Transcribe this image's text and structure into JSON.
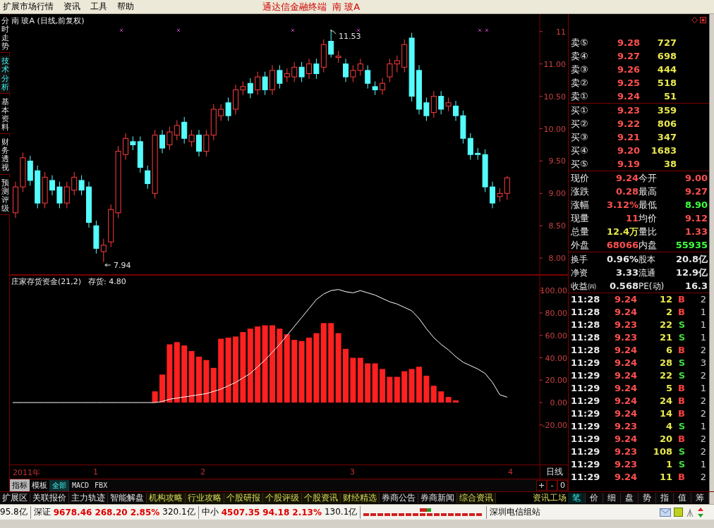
{
  "menu": {
    "items": [
      "扩展市场行情",
      "资讯",
      "工具",
      "帮助"
    ],
    "app_title": "通达信金融终端",
    "stock_title": "南 玻A"
  },
  "side_tabs": [
    {
      "label": "分时走势",
      "selected": false
    },
    {
      "label": "技术分析",
      "selected": true
    },
    {
      "label": "基本资料",
      "selected": false
    },
    {
      "label": "财务透视",
      "selected": false
    },
    {
      "label": "预测评级",
      "selected": false
    }
  ],
  "price_chart": {
    "title": "南 玻A (日线,前复权)",
    "high_label": "11.53",
    "low_label": "7.94",
    "chart_data": {
      "type": "candlestick",
      "ylim": [
        7.74,
        11.77
      ],
      "yticks": [
        {
          "value": 11.5,
          "label": "11"
        },
        {
          "value": 11,
          "label": "11.00"
        },
        {
          "value": 10.5,
          "label": "10.50"
        },
        {
          "value": 10,
          "label": "10.00"
        },
        {
          "value": 9.5,
          "label": "9.50"
        },
        {
          "value": 9,
          "label": "9.00"
        },
        {
          "value": 8.5,
          "label": "8.50"
        },
        {
          "value": 8,
          "label": "8.00"
        }
      ],
      "ohlc": [
        [
          8.7,
          9.18,
          8.62,
          9.1
        ],
        [
          9.1,
          9.63,
          9.02,
          9.55
        ],
        [
          9.5,
          9.58,
          9.12,
          9.2
        ],
        [
          9.35,
          9.43,
          8.77,
          8.85
        ],
        [
          8.85,
          9.33,
          8.77,
          9.25
        ],
        [
          9.2,
          9.28,
          8.97,
          9.05
        ],
        [
          9.1,
          9.18,
          8.77,
          8.85
        ],
        [
          8.85,
          9.18,
          8.77,
          9.1
        ],
        [
          9.05,
          9.33,
          8.97,
          9.25
        ],
        [
          9.2,
          9.28,
          8.97,
          9.05
        ],
        [
          9.1,
          9.18,
          8.47,
          8.55
        ],
        [
          8.5,
          8.58,
          8.07,
          8.15
        ],
        [
          8.1,
          8.3,
          7.94,
          8.2
        ],
        [
          8.25,
          8.83,
          8.17,
          8.75
        ],
        [
          8.7,
          9.73,
          8.62,
          9.65
        ],
        [
          9.6,
          9.93,
          9.52,
          9.85
        ],
        [
          9.8,
          9.88,
          9.67,
          9.75
        ],
        [
          9.8,
          9.88,
          9.32,
          9.4
        ],
        [
          9.35,
          9.43,
          9.07,
          9.15
        ],
        [
          9.0,
          9.98,
          8.92,
          9.9
        ],
        [
          9.9,
          9.98,
          9.62,
          9.7
        ],
        [
          9.75,
          10.03,
          9.67,
          9.95
        ],
        [
          9.9,
          10.13,
          9.82,
          10.05
        ],
        [
          10.1,
          10.18,
          9.77,
          9.85
        ],
        [
          9.8,
          9.98,
          9.72,
          9.9
        ],
        [
          9.9,
          9.98,
          9.57,
          9.65
        ],
        [
          9.65,
          9.98,
          9.57,
          9.9
        ],
        [
          9.9,
          10.38,
          9.82,
          10.3
        ],
        [
          10.2,
          10.38,
          10.12,
          10.3
        ],
        [
          10.4,
          10.48,
          10.12,
          10.2
        ],
        [
          10.3,
          10.68,
          10.22,
          10.6
        ],
        [
          10.6,
          10.73,
          10.52,
          10.65
        ],
        [
          10.7,
          10.78,
          10.47,
          10.55
        ],
        [
          10.6,
          10.88,
          10.52,
          10.8
        ],
        [
          10.8,
          10.88,
          10.52,
          10.6
        ],
        [
          10.6,
          10.98,
          10.52,
          10.9
        ],
        [
          10.9,
          10.98,
          10.62,
          10.7
        ],
        [
          10.8,
          10.93,
          10.72,
          10.85
        ],
        [
          10.8,
          11.03,
          10.72,
          10.95
        ],
        [
          10.95,
          11.03,
          10.72,
          10.8
        ],
        [
          10.85,
          11.08,
          10.77,
          11.0
        ],
        [
          11.0,
          11.08,
          10.77,
          10.85
        ],
        [
          10.95,
          11.38,
          10.87,
          11.3
        ],
        [
          11.35,
          11.53,
          11.1,
          11.15
        ],
        [
          11.1,
          11.2,
          11.02,
          11.12
        ],
        [
          11.0,
          11.08,
          10.72,
          10.8
        ],
        [
          10.8,
          10.98,
          10.72,
          10.9
        ],
        [
          10.9,
          11.08,
          10.82,
          11.0
        ],
        [
          10.9,
          10.98,
          10.62,
          10.7
        ],
        [
          10.65,
          10.73,
          10.52,
          10.6
        ],
        [
          10.6,
          10.78,
          10.52,
          10.7
        ],
        [
          10.8,
          11.08,
          10.72,
          11.0
        ],
        [
          11.0,
          11.13,
          10.87,
          11.05
        ],
        [
          10.95,
          11.38,
          10.87,
          11.3
        ],
        [
          11.4,
          11.48,
          10.42,
          10.5
        ],
        [
          10.9,
          10.98,
          10.22,
          10.3
        ],
        [
          10.4,
          10.48,
          10.12,
          10.2
        ],
        [
          10.25,
          10.58,
          10.17,
          10.5
        ],
        [
          10.5,
          10.58,
          10.22,
          10.3
        ],
        [
          10.35,
          10.48,
          10.27,
          10.4
        ],
        [
          10.35,
          10.43,
          10.12,
          10.2
        ],
        [
          10.2,
          10.28,
          9.77,
          9.85
        ],
        [
          9.85,
          9.93,
          9.52,
          9.6
        ],
        [
          9.62,
          9.7,
          9.52,
          9.6
        ],
        [
          9.6,
          9.68,
          9.02,
          9.1
        ],
        [
          9.1,
          9.18,
          8.77,
          8.85
        ],
        [
          8.95,
          9.08,
          8.87,
          9.0
        ],
        [
          9.0,
          9.27,
          8.9,
          9.24
        ]
      ]
    }
  },
  "indicator_chart": {
    "reading": "存货: 4.80",
    "chart_data": {
      "type": "bar",
      "title": "庄家存货资金(21,2)",
      "ylim": [
        -56,
        114
      ],
      "yticks": [
        {
          "value": 100,
          "label": "100.00"
        },
        {
          "value": 80,
          "label": "80.00"
        },
        {
          "value": 60,
          "label": "60.00"
        },
        {
          "value": 40,
          "label": "40.00"
        },
        {
          "value": 20,
          "label": "20.00"
        },
        {
          "value": 0,
          "label": "0.00"
        },
        {
          "value": -20,
          "label": "-20.00"
        }
      ],
      "series": [
        {
          "type": "bar",
          "color": "#ff2020",
          "values": [
            null,
            null,
            null,
            null,
            null,
            null,
            null,
            null,
            null,
            null,
            null,
            null,
            null,
            null,
            null,
            null,
            null,
            null,
            null,
            10,
            25,
            52,
            54,
            51,
            46,
            41,
            38,
            31,
            57,
            58,
            59,
            63,
            66,
            68,
            69,
            69,
            66,
            61,
            56,
            55,
            58,
            62,
            71,
            71,
            62,
            48,
            40,
            40,
            35,
            35,
            30,
            23,
            23,
            28,
            30,
            32,
            24,
            15,
            10,
            5,
            2,
            null,
            null,
            null,
            null,
            null,
            null,
            null
          ]
        },
        {
          "type": "line",
          "color": "#ffffff",
          "values": [
            0,
            0,
            0,
            0,
            0,
            0,
            0,
            0,
            0,
            0,
            0,
            0,
            0,
            0,
            0,
            0,
            0,
            0,
            0,
            0,
            1,
            3,
            4,
            5,
            6,
            7,
            8,
            10,
            12,
            15,
            18,
            22,
            26,
            32,
            38,
            45,
            52,
            60,
            68,
            76,
            84,
            92,
            97,
            100,
            101,
            99,
            98,
            100,
            98,
            96,
            93,
            90,
            88,
            85,
            82,
            75,
            66,
            58,
            52,
            47,
            41,
            36,
            33,
            30,
            26,
            18,
            7,
            4.8
          ]
        }
      ]
    }
  },
  "date_axis": {
    "labels": [
      "2011年",
      "1",
      "2",
      "3",
      "4"
    ],
    "period": "日线"
  },
  "indicator_tabs": [
    {
      "label": "指标",
      "selected": true
    },
    {
      "label": "模板",
      "selected": false
    }
  ],
  "indicator_filters": [
    {
      "label": "全部",
      "selected": true
    },
    {
      "label": "MACD",
      "selected": false
    },
    {
      "label": "FBX",
      "selected": false
    }
  ],
  "zoom_buttons": [
    "+",
    "-",
    "0"
  ],
  "toolbar": {
    "items": [
      {
        "label": "扩展区",
        "highlighted": false
      },
      {
        "label": "关联报价",
        "highlighted": false
      },
      {
        "label": "主力轨迹",
        "highlighted": false
      },
      {
        "label": "智能解盘",
        "highlighted": false
      },
      {
        "label": "机构攻略",
        "highlighted": true
      },
      {
        "label": "行业攻略",
        "highlighted": true
      },
      {
        "label": "个股研报",
        "highlighted": true
      },
      {
        "label": "个股评级",
        "highlighted": true
      },
      {
        "label": "个股资讯",
        "highlighted": true
      },
      {
        "label": "财经精选",
        "highlighted": true
      },
      {
        "label": "券商公告",
        "highlighted": false
      },
      {
        "label": "券商新闻",
        "highlighted": false
      },
      {
        "label": "综合资讯",
        "highlighted": true
      }
    ],
    "workshop": "资讯工场"
  },
  "detail_tabs": [
    {
      "label": "笔",
      "selected": true
    },
    {
      "label": "价",
      "selected": false
    },
    {
      "label": "细",
      "selected": false
    },
    {
      "label": "盘",
      "selected": false
    },
    {
      "label": "势",
      "selected": false
    },
    {
      "label": "指",
      "selected": false
    },
    {
      "label": "值",
      "selected": false
    },
    {
      "label": "筹",
      "selected": false
    }
  ],
  "order_book": {
    "asks": [
      {
        "label": "卖⑤",
        "price": "9.28",
        "volume": "727"
      },
      {
        "label": "卖④",
        "price": "9.27",
        "volume": "698"
      },
      {
        "label": "卖③",
        "price": "9.26",
        "volume": "444"
      },
      {
        "label": "卖②",
        "price": "9.25",
        "volume": "518"
      },
      {
        "label": "卖①",
        "price": "9.24",
        "volume": "51"
      }
    ],
    "bids": [
      {
        "label": "买①",
        "price": "9.23",
        "volume": "359"
      },
      {
        "label": "买②",
        "price": "9.22",
        "volume": "806"
      },
      {
        "label": "买③",
        "price": "9.21",
        "volume": "347"
      },
      {
        "label": "买④",
        "price": "9.20",
        "volume": "1683"
      },
      {
        "label": "买⑤",
        "price": "9.19",
        "volume": "38"
      }
    ]
  },
  "quote_stats": [
    {
      "label": "现价",
      "value": "9.24",
      "color": "#ff5050"
    },
    {
      "label": "今开",
      "value": "9.00",
      "color": "#ff5050"
    },
    {
      "label": "涨跌",
      "value": "0.28",
      "color": "#ff5050"
    },
    {
      "label": "最高",
      "value": "9.27",
      "color": "#ff5050"
    },
    {
      "label": "涨幅",
      "value": "3.12%",
      "color": "#ff5050"
    },
    {
      "label": "最低",
      "value": "8.90",
      "color": "#40ff40"
    },
    {
      "label": "现量",
      "value": "11",
      "color": "#ff5050"
    },
    {
      "label": "均价",
      "value": "9.12",
      "color": "#ff5050"
    },
    {
      "label": "总量",
      "value": "12.4万",
      "color": "#e8e850"
    },
    {
      "label": "量比",
      "value": "1.33",
      "color": "#ff5050"
    },
    {
      "label": "外盘",
      "value": "68066",
      "color": "#ff5050"
    },
    {
      "label": "内盘",
      "value": "55935",
      "color": "#40ff40"
    }
  ],
  "fundamentals": [
    {
      "label": "换手",
      "value": "0.96%"
    },
    {
      "label": "股本",
      "value": "20.8亿"
    },
    {
      "label": "净资",
      "value": "3.33"
    },
    {
      "label": "流通",
      "value": "12.9亿"
    },
    {
      "label": "收益㈣",
      "value": "0.568"
    },
    {
      "label": "PE(动)",
      "value": "16.3"
    }
  ],
  "trades": [
    {
      "time": "11:28",
      "price": "9.24",
      "volume": "12",
      "side": "B",
      "kind": "buy",
      "count": "2"
    },
    {
      "time": "11:28",
      "price": "9.24",
      "volume": "2",
      "side": "B",
      "kind": "buy",
      "count": "1"
    },
    {
      "time": "11:28",
      "price": "9.23",
      "volume": "22",
      "side": "S",
      "kind": "sell",
      "count": "1"
    },
    {
      "time": "11:28",
      "price": "9.23",
      "volume": "21",
      "side": "S",
      "kind": "sell",
      "count": "1"
    },
    {
      "time": "11:28",
      "price": "9.24",
      "volume": "6",
      "side": "B",
      "kind": "buy",
      "count": "2"
    },
    {
      "time": "11:29",
      "price": "9.24",
      "volume": "28",
      "side": "S",
      "kind": "sell",
      "count": "3"
    },
    {
      "time": "11:29",
      "price": "9.24",
      "volume": "22",
      "side": "S",
      "kind": "sell",
      "count": "2"
    },
    {
      "time": "11:29",
      "price": "9.24",
      "volume": "5",
      "side": "B",
      "kind": "buy",
      "count": "1"
    },
    {
      "time": "11:29",
      "price": "9.24",
      "volume": "24",
      "side": "B",
      "kind": "buy",
      "count": "2"
    },
    {
      "time": "11:29",
      "price": "9.24",
      "volume": "14",
      "side": "B",
      "kind": "buy",
      "count": "2"
    },
    {
      "time": "11:29",
      "price": "9.23",
      "volume": "4",
      "side": "S",
      "kind": "sell",
      "count": "1"
    },
    {
      "time": "11:29",
      "price": "9.24",
      "volume": "20",
      "side": "B",
      "kind": "buy",
      "count": "2"
    },
    {
      "time": "11:29",
      "price": "9.23",
      "volume": "108",
      "side": "S",
      "kind": "sell",
      "count": "2"
    },
    {
      "time": "11:29",
      "price": "9.23",
      "volume": "1",
      "side": "S",
      "kind": "sell",
      "count": "1"
    },
    {
      "time": "11:29",
      "price": "9.24",
      "volume": "11",
      "side": "B",
      "kind": "buy",
      "count": "2"
    }
  ],
  "status_bar": {
    "lead": "95.8亿",
    "indices": [
      {
        "name": "深证",
        "value": "9678.46",
        "change": "268.20",
        "percent": "2.85%",
        "amount": "320.1亿"
      },
      {
        "name": "中小",
        "value": "4507.35",
        "change": "94.18",
        "percent": "2.13%",
        "amount": "130.1亿"
      }
    ],
    "server": "深圳电信组站"
  }
}
